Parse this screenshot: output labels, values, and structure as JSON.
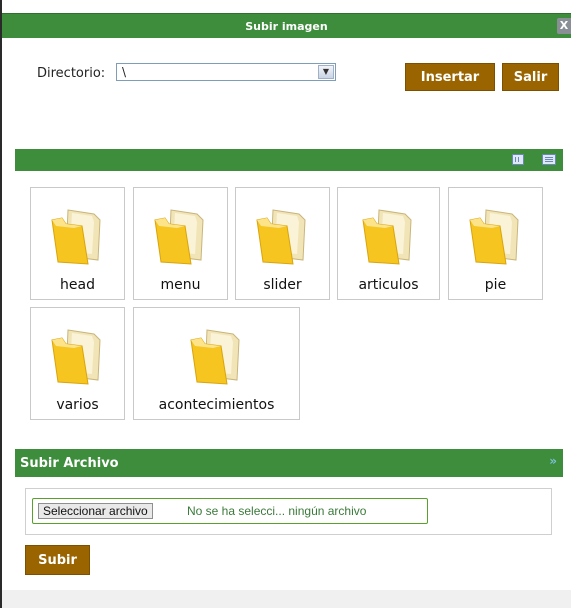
{
  "dialog": {
    "title": "Subir imagen",
    "close_label": "X"
  },
  "directory": {
    "label": "Directorio:",
    "value": "\\"
  },
  "buttons": {
    "insert": "Insertar",
    "exit": "Salir",
    "upload": "Subir"
  },
  "view_icons": [
    "thumbnails-view-icon",
    "list-view-icon"
  ],
  "folders": [
    "head",
    "menu",
    "slider",
    "articulos",
    "pie",
    "varios",
    "acontecimientos"
  ],
  "upload_section": {
    "title": "Subir Archivo",
    "chevron": "»",
    "file_button": "Seleccionar archivo",
    "file_status": "No se ha selecci... ningún archivo"
  },
  "colors": {
    "green_bar": "#3d8d3d",
    "brown_button": "#9a6400",
    "folder_yellow": "#f2c21f"
  }
}
